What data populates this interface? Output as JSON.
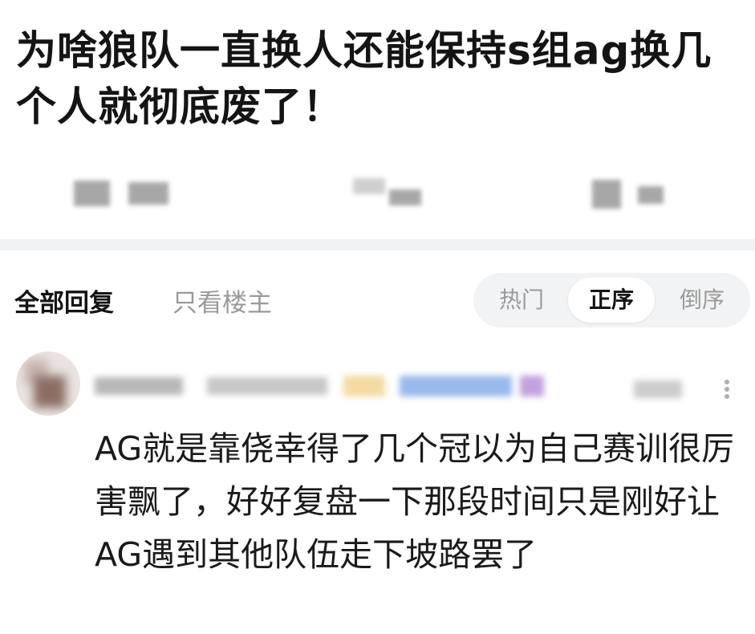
{
  "post": {
    "title": "为啥狼队一直换人还能保持s组ag换几个人就彻底废了！"
  },
  "reply_tabs": {
    "all": "全部回复",
    "op_only": "只看楼主"
  },
  "sort": {
    "hot": "热门",
    "ascending": "正序",
    "descending": "倒序",
    "active": "正序"
  },
  "comment": {
    "text": "AG就是靠侥幸得了几个冠以为自己赛训很厉害飘了，好好复盘一下那段时间只是刚好让AG遇到其他队伍走下坡路罢了"
  },
  "icons": {
    "more": "more-vertical-icon"
  },
  "colors": {
    "title": "#141414",
    "muted": "#9a9a9a",
    "pill_bg": "#f2f3f5",
    "divider": "#f1f2f4",
    "badge_yellow": "#f2d28c",
    "badge_blue": "#7fa8e8",
    "badge_purple": "#b58ad6"
  }
}
